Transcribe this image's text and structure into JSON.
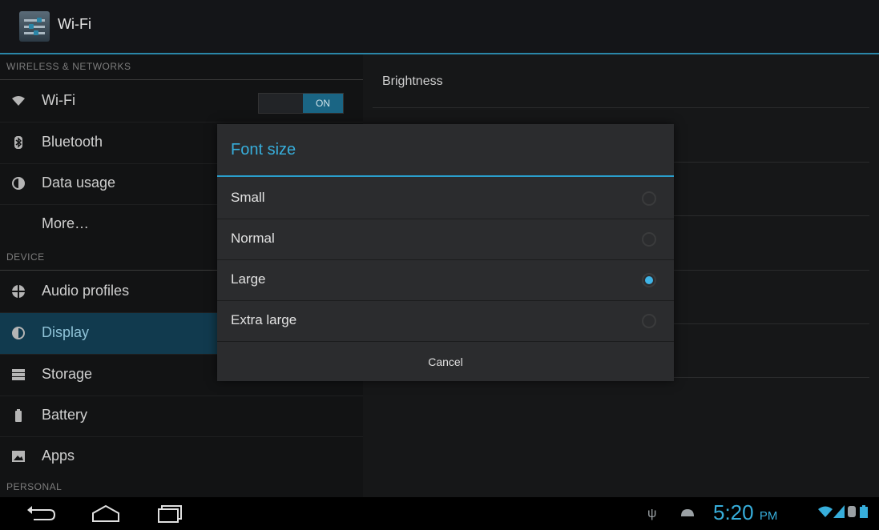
{
  "actionbar": {
    "title": "Wi-Fi"
  },
  "sidebar": {
    "sections": [
      {
        "header": "WIRELESS & NETWORKS"
      },
      {
        "header": "DEVICE"
      },
      {
        "header": "PERSONAL"
      }
    ],
    "items": [
      {
        "label": "Wi-Fi",
        "icon": "wifi-icon"
      },
      {
        "label": "Bluetooth",
        "icon": "bluetooth-icon"
      },
      {
        "label": "Data usage",
        "icon": "data-usage-icon"
      },
      {
        "label": "More…",
        "icon": ""
      },
      {
        "label": "Audio profiles",
        "icon": "audio-profiles-icon"
      },
      {
        "label": "Display",
        "icon": "display-icon",
        "selected": true
      },
      {
        "label": "Storage",
        "icon": "storage-icon"
      },
      {
        "label": "Battery",
        "icon": "battery-icon"
      },
      {
        "label": "Apps",
        "icon": "apps-icon"
      }
    ],
    "wifi_toggle": {
      "state_label": "ON"
    }
  },
  "main": {
    "first_item": "Brightness"
  },
  "dialog": {
    "title": "Font size",
    "options": [
      {
        "label": "Small",
        "checked": false
      },
      {
        "label": "Normal",
        "checked": false
      },
      {
        "label": "Large",
        "checked": true
      },
      {
        "label": "Extra large",
        "checked": false
      }
    ],
    "cancel_label": "Cancel"
  },
  "statusbar": {
    "time": "5:20",
    "ampm": "PM"
  },
  "colors": {
    "accent": "#37aedb",
    "selected_bg": "#113a4e"
  }
}
